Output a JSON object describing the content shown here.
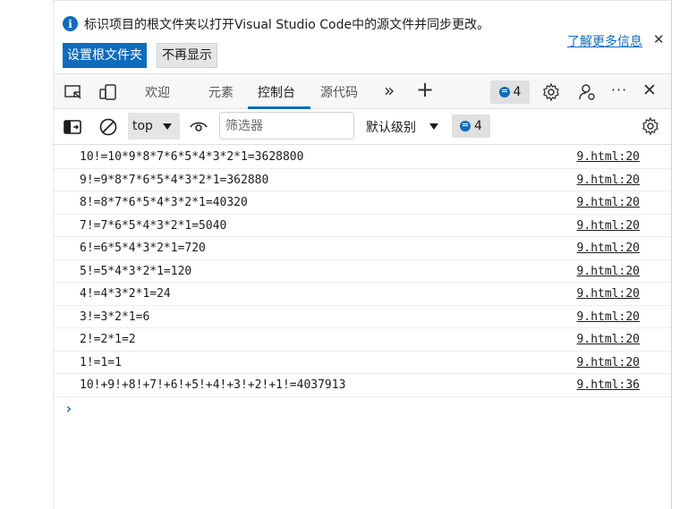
{
  "infobar": {
    "message": "标识项目的根文件夹以打开Visual Studio Code中的源文件并同步更改。",
    "learn_more": "了解更多信息",
    "close": "✕",
    "set_root_label": "设置根文件夹",
    "dont_show_label": "不再显示"
  },
  "toolbar": {
    "tabs": [
      {
        "label": "欢迎"
      },
      {
        "label": "元素"
      },
      {
        "label": "控制台"
      },
      {
        "label": "源代码"
      }
    ],
    "more_tabs": "»",
    "add_tab": "+",
    "issues_count": "4",
    "more_options": "···",
    "close": "✕"
  },
  "console_toolbar": {
    "context": "top",
    "filter_placeholder": "筛选器",
    "level": "默认级别",
    "issues_count": "4"
  },
  "console": {
    "rows": [
      {
        "message": "10!=10*9*8*7*6*5*4*3*2*1=3628800",
        "source": "9.html:20"
      },
      {
        "message": "9!=9*8*7*6*5*4*3*2*1=362880",
        "source": "9.html:20"
      },
      {
        "message": "8!=8*7*6*5*4*3*2*1=40320",
        "source": "9.html:20"
      },
      {
        "message": "7!=7*6*5*4*3*2*1=5040",
        "source": "9.html:20"
      },
      {
        "message": "6!=6*5*4*3*2*1=720",
        "source": "9.html:20"
      },
      {
        "message": "5!=5*4*3*2*1=120",
        "source": "9.html:20"
      },
      {
        "message": "4!=4*3*2*1=24",
        "source": "9.html:20"
      },
      {
        "message": "3!=3*2*1=6",
        "source": "9.html:20"
      },
      {
        "message": "2!=2*1=2",
        "source": "9.html:20"
      },
      {
        "message": "1!=1=1",
        "source": "9.html:20"
      },
      {
        "message": "10!+9!+8!+7!+6!+5!+4!+3!+2!+1!=4037913",
        "source": "9.html:36"
      }
    ],
    "prompt": "›"
  },
  "colors": {
    "accent": "#0f6cbd",
    "toolbar_bg": "#f7f7f7"
  }
}
